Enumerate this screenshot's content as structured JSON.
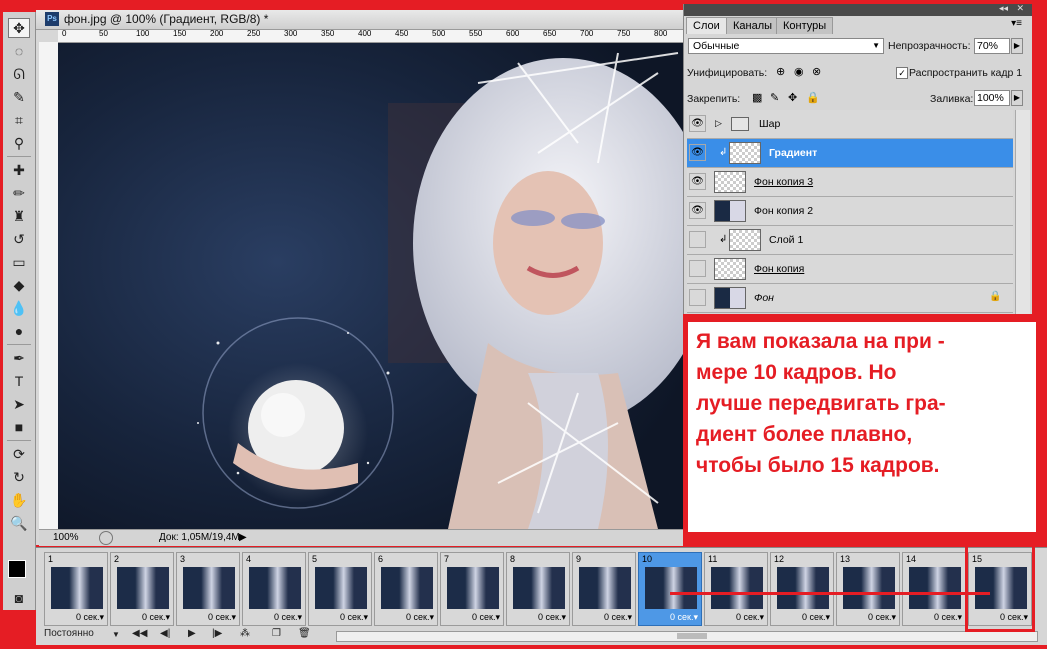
{
  "document": {
    "title": "фон.jpg @ 100% (Градиент, RGB/8) *",
    "ruler_ticks": [
      "0",
      "50",
      "100",
      "150",
      "200",
      "250",
      "300",
      "350",
      "400",
      "450",
      "500",
      "550",
      "600",
      "650",
      "700",
      "750",
      "800"
    ],
    "zoom": "100%",
    "doc_size": "Док: 1,05M/19,4M"
  },
  "layers_panel": {
    "tabs": [
      "Слои",
      "Каналы",
      "Контуры"
    ],
    "blend_mode": "Обычные",
    "opacity_label": "Непрозрачность:",
    "opacity_value": "70%",
    "unify_label": "Унифицировать:",
    "propagate_label": "Распространить кадр 1",
    "lock_label": "Закрепить:",
    "fill_label": "Заливка:",
    "fill_value": "100%",
    "layers": [
      {
        "name": "Шар"
      },
      {
        "name": "Градиент"
      },
      {
        "name": "Фон копия 3"
      },
      {
        "name": "Фон копия 2"
      },
      {
        "name": "Слой 1"
      },
      {
        "name": "Фон копия"
      },
      {
        "name": "Фон"
      }
    ]
  },
  "annotation": {
    "lines": [
      "Я вам показала на при -",
      "мере 10 кадров. Но",
      "лучше передвигать гра-",
      "диент более плавно,",
      "чтобы было 15 кадров."
    ]
  },
  "animation": {
    "frames": [
      {
        "num": "1",
        "delay": "0 сек."
      },
      {
        "num": "2",
        "delay": "0 сек."
      },
      {
        "num": "3",
        "delay": "0 сек."
      },
      {
        "num": "4",
        "delay": "0 сек."
      },
      {
        "num": "5",
        "delay": "0 сек."
      },
      {
        "num": "6",
        "delay": "0 сек."
      },
      {
        "num": "7",
        "delay": "0 сек."
      },
      {
        "num": "8",
        "delay": "0 сек."
      },
      {
        "num": "9",
        "delay": "0 сек."
      },
      {
        "num": "10",
        "delay": "0 сек."
      },
      {
        "num": "11",
        "delay": "0 сек."
      },
      {
        "num": "12",
        "delay": "0 сек."
      },
      {
        "num": "13",
        "delay": "0 сек."
      },
      {
        "num": "14",
        "delay": "0 сек."
      },
      {
        "num": "15",
        "delay": "0 сек."
      }
    ],
    "selected_frame": "10",
    "loop_mode": "Постоянно"
  },
  "colors": {
    "accent": "#e51d24",
    "selection": "#3a8ee8"
  }
}
